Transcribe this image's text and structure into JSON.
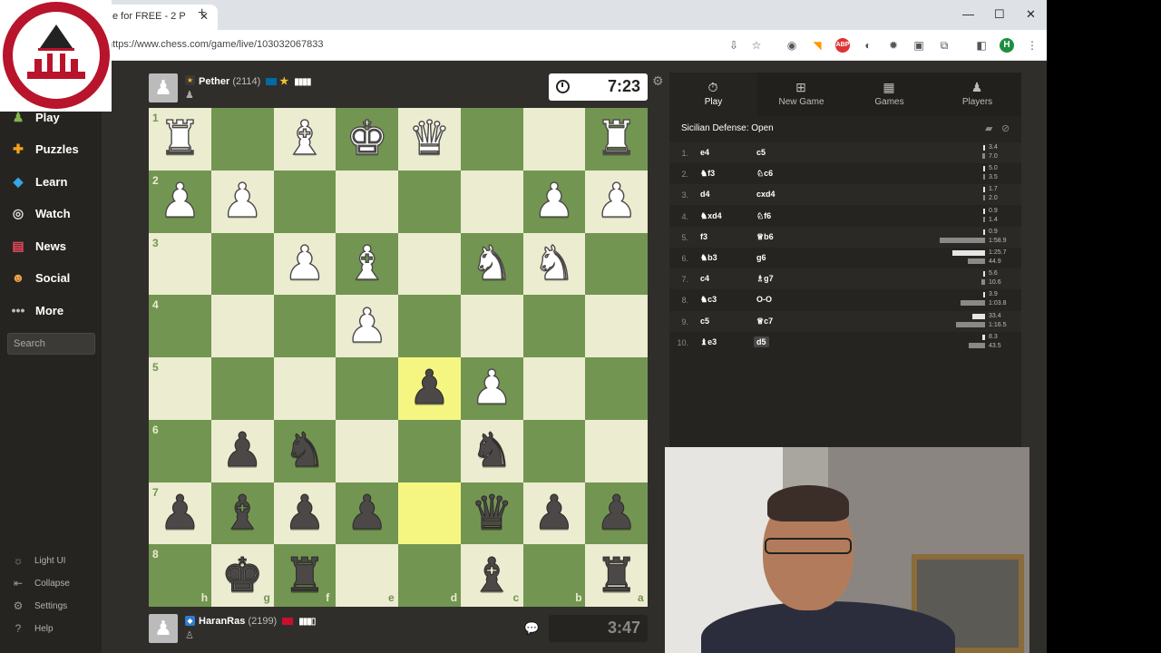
{
  "browser": {
    "tab_title": "e for FREE - 2 P",
    "url": "https://www.chess.com/game/live/103032067833",
    "avatar_letter": "H"
  },
  "sidebar": {
    "items": [
      {
        "label": "Play",
        "icon": "play-icon"
      },
      {
        "label": "Puzzles",
        "icon": "puzzles-icon"
      },
      {
        "label": "Learn",
        "icon": "learn-icon"
      },
      {
        "label": "Watch",
        "icon": "watch-icon"
      },
      {
        "label": "News",
        "icon": "news-icon"
      },
      {
        "label": "Social",
        "icon": "social-icon"
      },
      {
        "label": "More",
        "icon": "more-icon"
      }
    ],
    "search_placeholder": "Search",
    "footer": [
      {
        "label": "Light UI",
        "icon": "sun-icon"
      },
      {
        "label": "Collapse",
        "icon": "collapse-icon"
      },
      {
        "label": "Settings",
        "icon": "gear-icon"
      },
      {
        "label": "Help",
        "icon": "help-icon"
      }
    ]
  },
  "top_player": {
    "name": "Pether",
    "rating": "(2114)",
    "clock": "7:23"
  },
  "bottom_player": {
    "name": "HaranRas",
    "rating": "(2199)",
    "clock": "3:47"
  },
  "board": {
    "ranks": [
      "1",
      "2",
      "3",
      "4",
      "5",
      "6",
      "7",
      "8"
    ],
    "files": [
      "h",
      "g",
      "f",
      "e",
      "d",
      "c",
      "b",
      "a"
    ],
    "pieces": [
      [
        "wR",
        "",
        "wB",
        "wK",
        "wQ",
        "",
        "",
        "wR"
      ],
      [
        "wP",
        "wP",
        "",
        "",
        "",
        "",
        "wP",
        "wP"
      ],
      [
        "",
        "",
        "wP",
        "wB",
        "",
        "wN",
        "wN",
        ""
      ],
      [
        "",
        "",
        "",
        "wP",
        "",
        "",
        "",
        ""
      ],
      [
        "",
        "",
        "",
        "",
        "bP",
        "wP",
        "",
        ""
      ],
      [
        "",
        "bP",
        "bN",
        "",
        "",
        "bN",
        "",
        ""
      ],
      [
        "bP",
        "bB",
        "bP",
        "bP",
        "",
        "bQ",
        "bP",
        "bP"
      ],
      [
        "",
        "bK",
        "bR",
        "",
        "",
        "bB",
        "",
        "bR"
      ]
    ]
  },
  "panel": {
    "tabs": [
      {
        "label": "Play",
        "icon": "stopwatch-icon"
      },
      {
        "label": "New Game",
        "icon": "plus-icon"
      },
      {
        "label": "Games",
        "icon": "board-icon"
      },
      {
        "label": "Players",
        "icon": "players-icon"
      }
    ],
    "opening": "Sicilian Defense: Open",
    "moves": [
      {
        "num": "1.",
        "white": "e4",
        "black": "c5",
        "wt": "3.4",
        "bt": "7.0",
        "wv": 3.4,
        "bv": 7.0
      },
      {
        "num": "2.",
        "white": "♞f3",
        "black": "♘c6",
        "wt": "5.0",
        "bt": "3.5",
        "wv": 5.0,
        "bv": 3.5
      },
      {
        "num": "3.",
        "white": "d4",
        "black": "cxd4",
        "wt": "1.7",
        "bt": "2.0",
        "wv": 1.7,
        "bv": 2.0
      },
      {
        "num": "4.",
        "white": "♞xd4",
        "black": "♘f6",
        "wt": "0.9",
        "bt": "1.4",
        "wv": 0.9,
        "bv": 1.4
      },
      {
        "num": "5.",
        "white": "f3",
        "black": "♕b6",
        "wt": "0.9",
        "bt": "1:58.9",
        "wv": 0.9,
        "bv": 118.9
      },
      {
        "num": "6.",
        "white": "♞b3",
        "black": "g6",
        "wt": "1:25.7",
        "bt": "44.9",
        "wv": 85.7,
        "bv": 44.9
      },
      {
        "num": "7.",
        "white": "c4",
        "black": "♗g7",
        "wt": "5.6",
        "bt": "10.6",
        "wv": 5.6,
        "bv": 10.6
      },
      {
        "num": "8.",
        "white": "♞c3",
        "black": "O-O",
        "wt": "3.9",
        "bt": "1:03.8",
        "wv": 3.9,
        "bv": 63.8
      },
      {
        "num": "9.",
        "white": "c5",
        "black": "♕c7",
        "wt": "33.4",
        "bt": "1:16.5",
        "wv": 33.4,
        "bv": 76.5
      },
      {
        "num": "10.",
        "white": "♝e3",
        "black": "d5",
        "wt": "8.3",
        "bt": "43.5",
        "wv": 8.3,
        "bv": 43.5
      }
    ]
  },
  "colors": {
    "board_light": "#ebecd0",
    "board_dark": "#739552",
    "highlight_light": "#f5f682",
    "highlight_dark": "#b9ca43",
    "logo_red": "#b8142b"
  }
}
